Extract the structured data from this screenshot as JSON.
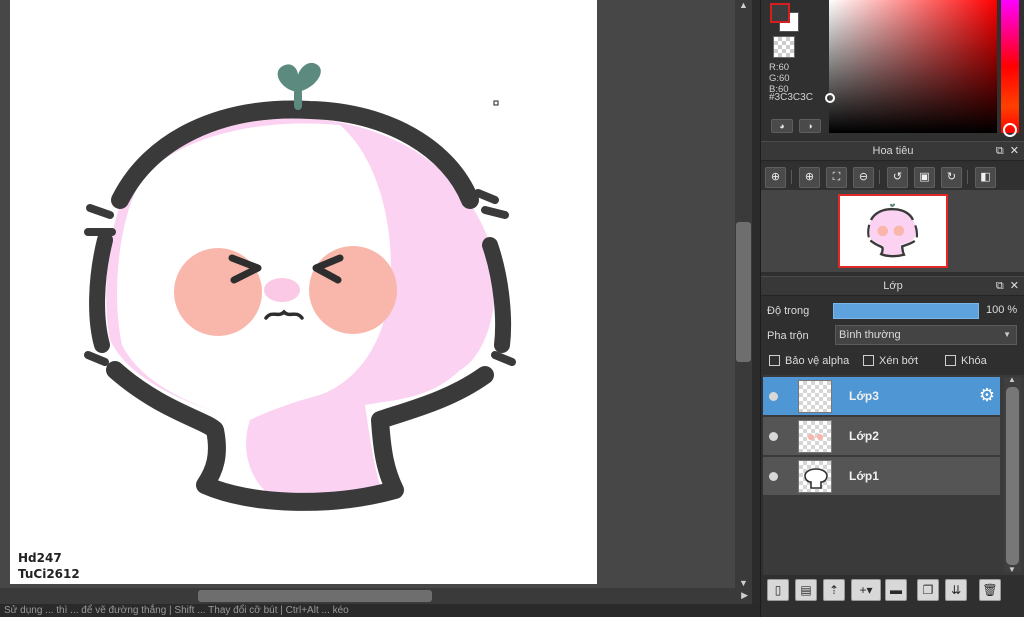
{
  "canvas": {
    "signature_line1": "Hd247",
    "signature_line2": "TuCi2612"
  },
  "status_bar": {
    "text": "Sử dụng ... thì ... để vẽ đường thẳng | Shift ... Thay đổi cỡ bút | Ctrl+Alt ... kéo"
  },
  "color_panel": {
    "foreground": "#3C3C3C",
    "background": "#FFFFFF",
    "r_label": "R:60",
    "g_label": "G:60",
    "b_label": "B:60",
    "hex_label": "#3C3C3C",
    "tools": [
      "palette-icon",
      "swap-icon"
    ]
  },
  "navigator": {
    "title": "Hoa tiêu",
    "buttons": [
      "zoom-fit-icon",
      "zoom-in-icon",
      "actual-size-icon",
      "zoom-out-icon",
      "rotate-left-icon",
      "fit-screen-icon",
      "rotate-right-icon",
      "flip-icon"
    ]
  },
  "layers_panel": {
    "title": "Lớp",
    "opacity_label": "Độ trong",
    "opacity_value": "100 %",
    "opacity_fraction": 1.0,
    "blend_label": "Pha trộn",
    "blend_value": "Bình thường",
    "checkboxes": [
      {
        "label": "Bảo vệ alpha",
        "checked": false
      },
      {
        "label": "Xén bớt",
        "checked": false
      },
      {
        "label": "Khóa",
        "checked": false
      }
    ],
    "layers": [
      {
        "name": "Lớp3",
        "selected": true,
        "visible": true
      },
      {
        "name": "Lớp2",
        "selected": false,
        "visible": true
      },
      {
        "name": "Lớp1",
        "selected": false,
        "visible": true
      }
    ],
    "bottom_buttons": [
      "new-layer-icon",
      "new-layer-from-copy-icon",
      "import-layer-icon",
      "add-layer-menu-icon",
      "folder-icon",
      "duplicate-layer-icon",
      "merge-layer-icon",
      "delete-layer-icon"
    ]
  },
  "header_buttons": {
    "undock": "⧉",
    "close": "✕"
  }
}
